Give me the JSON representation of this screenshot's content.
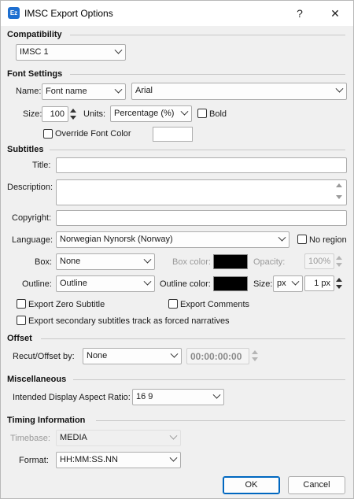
{
  "window": {
    "icon_text": "Ez",
    "title": "IMSC Export Options",
    "help_label": "?",
    "close_label": "✕"
  },
  "compatibility": {
    "section": "Compatibility",
    "value": "IMSC 1"
  },
  "font_settings": {
    "section": "Font Settings",
    "name_label": "Name:",
    "name_mode": "Font name",
    "font": "Arial",
    "size_label": "Size:",
    "size": "100",
    "units_label": "Units:",
    "units": "Percentage (%)",
    "bold_label": "Bold",
    "override_label": "Override Font Color",
    "override_color": "#ffffff"
  },
  "subtitles": {
    "section": "Subtitles",
    "title_label": "Title:",
    "title_value": "",
    "description_label": "Description:",
    "description_value": "",
    "copyright_label": "Copyright:",
    "copyright_value": "",
    "language_label": "Language:",
    "language": "Norwegian Nynorsk (Norway)",
    "no_region_label": "No region",
    "box_label": "Box:",
    "box": "None",
    "box_color_label": "Box color:",
    "box_color": "#000000",
    "opacity_label": "Opacity:",
    "opacity": "100%",
    "outline_label": "Outline:",
    "outline": "Outline",
    "outline_color_label": "Outline color:",
    "outline_color": "#000000",
    "outline_size_label": "Size:",
    "outline_unit": "px",
    "outline_size": "1 px",
    "export_zero_label": "Export Zero Subtitle",
    "export_comments_label": "Export Comments",
    "export_secondary_label": "Export secondary subtitles track as forced narratives"
  },
  "offset": {
    "section": "Offset",
    "recut_label": "Recut/Offset by:",
    "recut": "None",
    "timecode": "00:00:00:00"
  },
  "misc": {
    "section": "Miscellaneous",
    "aspect_label": "Intended Display Aspect Ratio:",
    "aspect": "16 9"
  },
  "timing": {
    "section": "Timing Information",
    "timebase_label": "Timebase:",
    "timebase": "MEDIA",
    "format_label": "Format:",
    "format": "HH:MM:SS.NN"
  },
  "buttons": {
    "ok": "OK",
    "cancel": "Cancel"
  }
}
